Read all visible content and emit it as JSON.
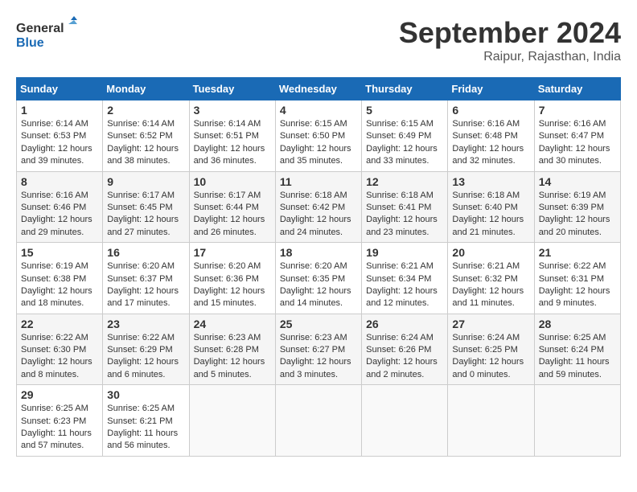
{
  "header": {
    "logo_line1": "General",
    "logo_line2": "Blue",
    "month": "September 2024",
    "location": "Raipur, Rajasthan, India"
  },
  "days_of_week": [
    "Sunday",
    "Monday",
    "Tuesday",
    "Wednesday",
    "Thursday",
    "Friday",
    "Saturday"
  ],
  "weeks": [
    [
      {
        "day": 1,
        "info": "Sunrise: 6:14 AM\nSunset: 6:53 PM\nDaylight: 12 hours and 39 minutes."
      },
      {
        "day": 2,
        "info": "Sunrise: 6:14 AM\nSunset: 6:52 PM\nDaylight: 12 hours and 38 minutes."
      },
      {
        "day": 3,
        "info": "Sunrise: 6:14 AM\nSunset: 6:51 PM\nDaylight: 12 hours and 36 minutes."
      },
      {
        "day": 4,
        "info": "Sunrise: 6:15 AM\nSunset: 6:50 PM\nDaylight: 12 hours and 35 minutes."
      },
      {
        "day": 5,
        "info": "Sunrise: 6:15 AM\nSunset: 6:49 PM\nDaylight: 12 hours and 33 minutes."
      },
      {
        "day": 6,
        "info": "Sunrise: 6:16 AM\nSunset: 6:48 PM\nDaylight: 12 hours and 32 minutes."
      },
      {
        "day": 7,
        "info": "Sunrise: 6:16 AM\nSunset: 6:47 PM\nDaylight: 12 hours and 30 minutes."
      }
    ],
    [
      {
        "day": 8,
        "info": "Sunrise: 6:16 AM\nSunset: 6:46 PM\nDaylight: 12 hours and 29 minutes."
      },
      {
        "day": 9,
        "info": "Sunrise: 6:17 AM\nSunset: 6:45 PM\nDaylight: 12 hours and 27 minutes."
      },
      {
        "day": 10,
        "info": "Sunrise: 6:17 AM\nSunset: 6:44 PM\nDaylight: 12 hours and 26 minutes."
      },
      {
        "day": 11,
        "info": "Sunrise: 6:18 AM\nSunset: 6:42 PM\nDaylight: 12 hours and 24 minutes."
      },
      {
        "day": 12,
        "info": "Sunrise: 6:18 AM\nSunset: 6:41 PM\nDaylight: 12 hours and 23 minutes."
      },
      {
        "day": 13,
        "info": "Sunrise: 6:18 AM\nSunset: 6:40 PM\nDaylight: 12 hours and 21 minutes."
      },
      {
        "day": 14,
        "info": "Sunrise: 6:19 AM\nSunset: 6:39 PM\nDaylight: 12 hours and 20 minutes."
      }
    ],
    [
      {
        "day": 15,
        "info": "Sunrise: 6:19 AM\nSunset: 6:38 PM\nDaylight: 12 hours and 18 minutes."
      },
      {
        "day": 16,
        "info": "Sunrise: 6:20 AM\nSunset: 6:37 PM\nDaylight: 12 hours and 17 minutes."
      },
      {
        "day": 17,
        "info": "Sunrise: 6:20 AM\nSunset: 6:36 PM\nDaylight: 12 hours and 15 minutes."
      },
      {
        "day": 18,
        "info": "Sunrise: 6:20 AM\nSunset: 6:35 PM\nDaylight: 12 hours and 14 minutes."
      },
      {
        "day": 19,
        "info": "Sunrise: 6:21 AM\nSunset: 6:34 PM\nDaylight: 12 hours and 12 minutes."
      },
      {
        "day": 20,
        "info": "Sunrise: 6:21 AM\nSunset: 6:32 PM\nDaylight: 12 hours and 11 minutes."
      },
      {
        "day": 21,
        "info": "Sunrise: 6:22 AM\nSunset: 6:31 PM\nDaylight: 12 hours and 9 minutes."
      }
    ],
    [
      {
        "day": 22,
        "info": "Sunrise: 6:22 AM\nSunset: 6:30 PM\nDaylight: 12 hours and 8 minutes."
      },
      {
        "day": 23,
        "info": "Sunrise: 6:22 AM\nSunset: 6:29 PM\nDaylight: 12 hours and 6 minutes."
      },
      {
        "day": 24,
        "info": "Sunrise: 6:23 AM\nSunset: 6:28 PM\nDaylight: 12 hours and 5 minutes."
      },
      {
        "day": 25,
        "info": "Sunrise: 6:23 AM\nSunset: 6:27 PM\nDaylight: 12 hours and 3 minutes."
      },
      {
        "day": 26,
        "info": "Sunrise: 6:24 AM\nSunset: 6:26 PM\nDaylight: 12 hours and 2 minutes."
      },
      {
        "day": 27,
        "info": "Sunrise: 6:24 AM\nSunset: 6:25 PM\nDaylight: 12 hours and 0 minutes."
      },
      {
        "day": 28,
        "info": "Sunrise: 6:25 AM\nSunset: 6:24 PM\nDaylight: 11 hours and 59 minutes."
      }
    ],
    [
      {
        "day": 29,
        "info": "Sunrise: 6:25 AM\nSunset: 6:23 PM\nDaylight: 11 hours and 57 minutes."
      },
      {
        "day": 30,
        "info": "Sunrise: 6:25 AM\nSunset: 6:21 PM\nDaylight: 11 hours and 56 minutes."
      },
      null,
      null,
      null,
      null,
      null
    ]
  ]
}
